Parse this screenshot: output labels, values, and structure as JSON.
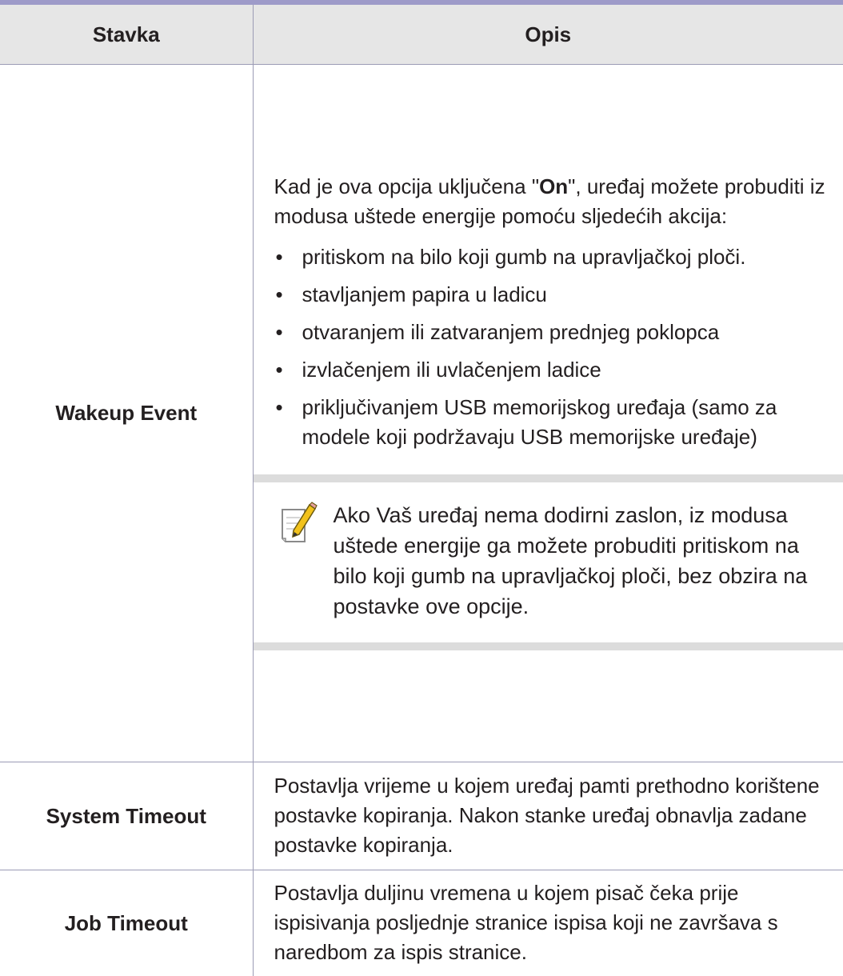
{
  "table": {
    "headers": {
      "item": "Stavka",
      "description": "Opis"
    },
    "rows": [
      {
        "item": "Wakeup Event",
        "intro_pre": "Kad je ova opcija uključena \"",
        "intro_bold": "On",
        "intro_post": "\", uređaj možete probuditi iz modusa uštede energije pomoću sljedećih akcija:",
        "bullets": [
          "pritiskom na bilo koji gumb na upravljačkoj ploči.",
          "stavljanjem papira u ladicu",
          "otvaranjem ili zatvaranjem prednjeg poklopca",
          "izvlačenjem ili uvlačenjem ladice",
          "priključivanjem USB memorijskog uređaja (samo za modele koji podržavaju USB memorijske uređaje)"
        ],
        "note": {
          "icon": "note-pencil-icon",
          "text": "Ako Vaš uređaj nema dodirni zaslon, iz modusa uštede energije ga možete probuditi pritiskom na bilo koji gumb na upravljačkoj ploči, bez obzira na postavke ove opcije."
        }
      },
      {
        "item": "System Timeout",
        "description": "Postavlja vrijeme u kojem uređaj pamti prethodno korištene postavke kopiranja. Nakon stanke uređaj obnavlja zadane postavke kopiranja."
      },
      {
        "item": "Job Timeout",
        "description": "Postavlja duljinu vremena u kojem pisač čeka prije ispisivanja posljednje stranice ispisa koji ne završava s naredbom za ispis stranice."
      }
    ]
  },
  "colors": {
    "top_rule": "#9e9bc9",
    "header_bg": "#e6e6e6",
    "border": "#9b9bb5",
    "note_band": "#dcdcdc",
    "note_icon_accent": "#f2c21b"
  }
}
